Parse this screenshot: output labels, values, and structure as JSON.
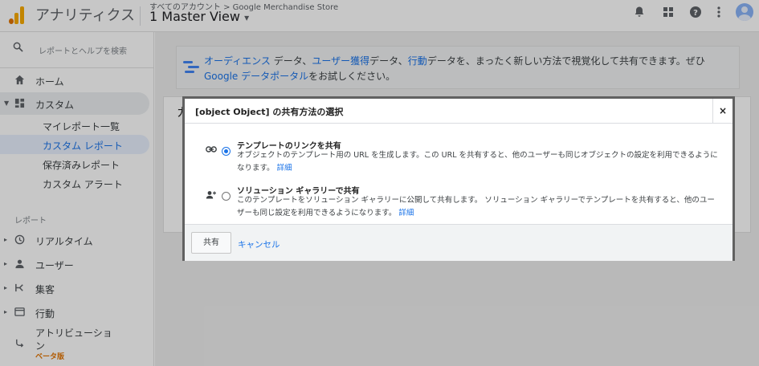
{
  "header": {
    "app_title": "アナリティクス",
    "breadcrumb": "すべてのアカウント > Google Merchandise Store",
    "view_name": "1 Master View",
    "view_caret": "▾"
  },
  "sidebar": {
    "search_placeholder": "レポートとヘルプを検索",
    "home": "ホーム",
    "custom": "カスタム",
    "custom_children": [
      "マイレポート一覧",
      "カスタム レポート",
      "保存済みレポート",
      "カスタム アラート"
    ],
    "reports_label": "レポート",
    "report_items": [
      "リアルタイム",
      "ユーザー",
      "集客",
      "行動"
    ],
    "attribution_line1": "アトリビューショ",
    "attribution_line2": "ン",
    "beta_label": "ベータ版"
  },
  "banner": {
    "link_audience": "オーディエンス",
    "text_data1": " データ、",
    "link_user_acq": "ユーザー獲得",
    "text_data2": "データ、",
    "link_behavior": "行動",
    "text_rest1": "データを、まったく新しい方法で視覚化して共有できます。ぜひ",
    "link_portal": "Google データポータル",
    "text_rest2": "をお試しください。"
  },
  "card": {
    "title_partial": "カ"
  },
  "dialog": {
    "title": "[object Object] の共有方法の選択",
    "close_label": "×",
    "option_template": {
      "title": "テンプレートのリンクを共有",
      "description": "オブジェクトのテンプレート用の URL を生成します。この URL を共有すると、他のユーザーも同じオブジェクトの設定を利用できるようになります。",
      "detail_link": "詳細",
      "selected": true
    },
    "option_gallery": {
      "title": "ソリューション ギャラリーで共有",
      "description": "このテンプレートをソリューション ギャラリーに公開して共有します。 ソリューション ギャラリーでテンプレートを共有すると、他のユーザーも同じ設定を利用できるようになります。",
      "detail_link": "詳細",
      "selected": false
    },
    "share_button": "共有",
    "cancel_link": "キャンセル"
  },
  "colors": {
    "accent": "#1a73e8",
    "beta": "#e37400",
    "dialog_border": "#616161"
  }
}
